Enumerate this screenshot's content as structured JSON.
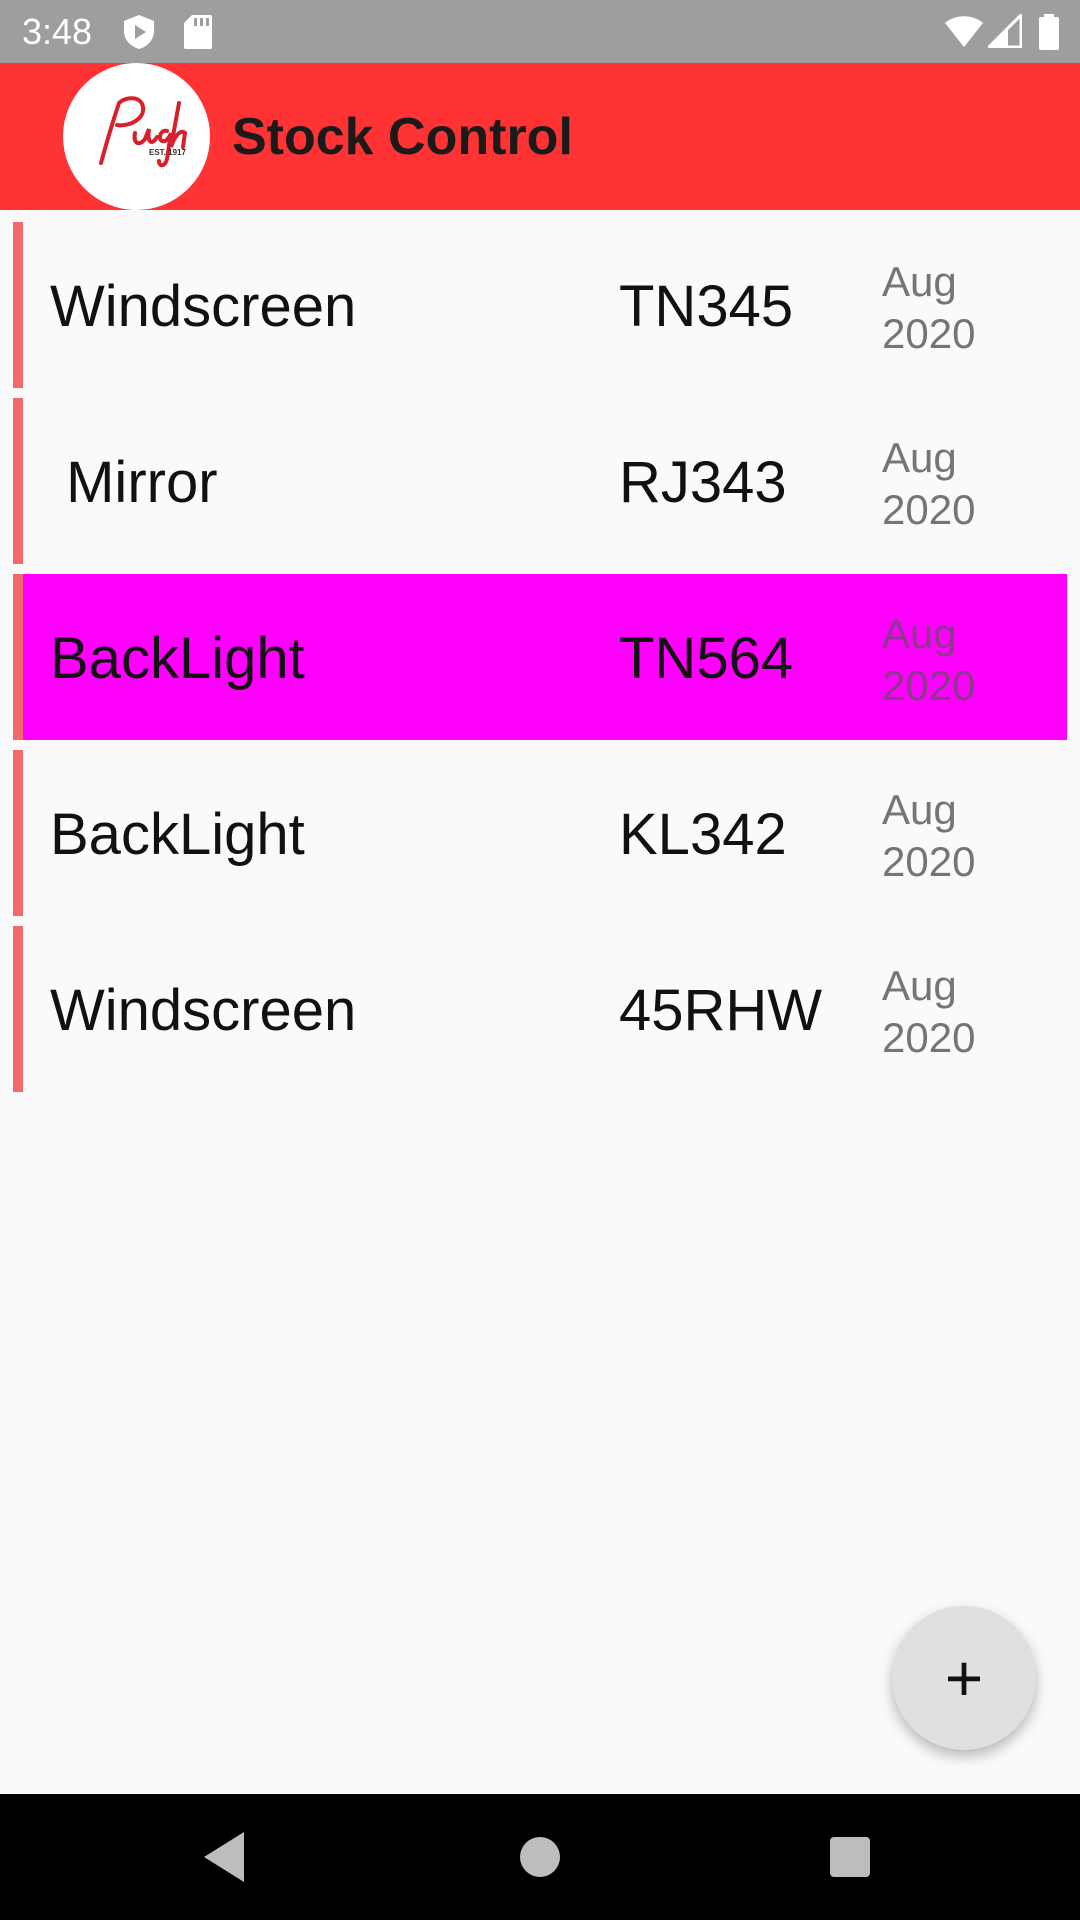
{
  "status_bar": {
    "time": "3:48",
    "icons": [
      "shield-play-icon",
      "sd-card-icon",
      "wifi-icon",
      "cellular-signal-icon",
      "battery-icon"
    ]
  },
  "app_bar": {
    "title": "Stock Control",
    "logo": {
      "script_text": "Pugh",
      "sub_text": "EST. 1917"
    },
    "color": "#ff3333"
  },
  "stock_list": {
    "items": [
      {
        "name": "Windscreen",
        "code": "TN345",
        "month": "Aug",
        "year": "2020",
        "selected": false
      },
      {
        "name": " Mirror",
        "code": "RJ343",
        "month": "Aug",
        "year": "2020",
        "selected": false
      },
      {
        "name": "BackLight",
        "code": "TN564",
        "month": "Aug",
        "year": "2020",
        "selected": true
      },
      {
        "name": "BackLight",
        "code": "KL342",
        "month": "Aug",
        "year": "2020",
        "selected": false
      },
      {
        "name": "Windscreen",
        "code": "45RHW",
        "month": "Aug",
        "year": "2020",
        "selected": false
      }
    ],
    "accent_color": "#f06a6a",
    "selected_color": "#ff00ff"
  },
  "fab": {
    "label": "+",
    "icon": "add-icon"
  },
  "nav_bar": {
    "buttons": [
      "back-icon",
      "home-icon",
      "recents-icon"
    ]
  }
}
